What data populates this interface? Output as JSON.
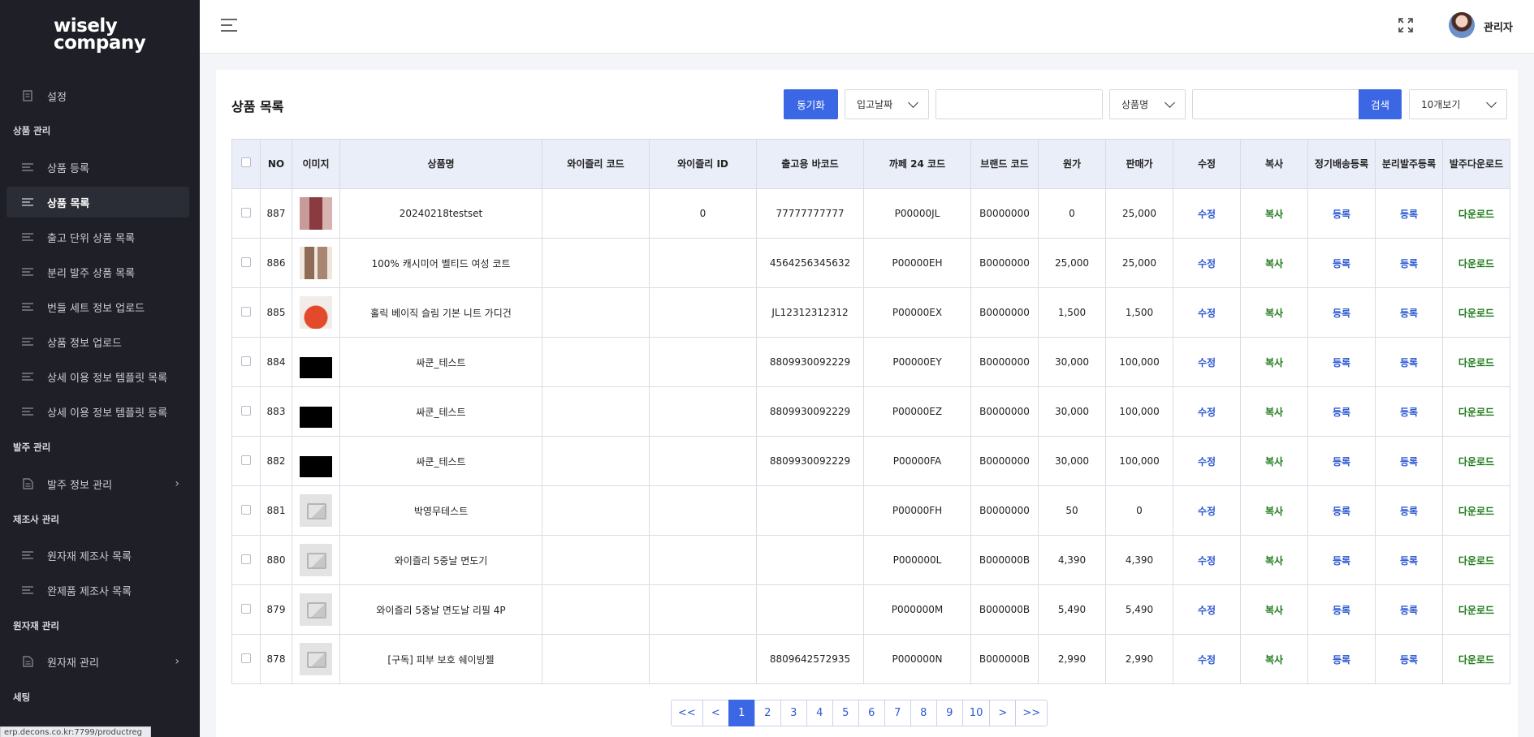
{
  "sidebar": {
    "logo_line1": "wisely",
    "logo_line2": "company",
    "settings": "설정",
    "section_product": "상품 관리",
    "product_items": [
      "상품 등록",
      "상품 목록",
      "출고 단위 상품 목록",
      "분리 발주 상품 목록",
      "번들 세트 정보 업로드",
      "상품 정보 업로드",
      "상세 이용 정보 템플릿 목록",
      "상세 이용 정보 템플릿 등록"
    ],
    "section_order": "발주 관리",
    "order_info": "발주 정보 관리",
    "section_maker": "제조사 관리",
    "maker_items": [
      "원자재 제조사 목록",
      "완제품 제조사 목록"
    ],
    "section_material": "원자재 관리",
    "material_mgmt": "원자재 관리",
    "section_setting": "세팅",
    "status_url": "erp.decons.co.kr:7799/productreg"
  },
  "topbar": {
    "user_name": "관리자"
  },
  "main": {
    "title": "상품 목록",
    "sync_button": "동기화",
    "date_filter": "입고날짜",
    "field_filter": "상품명",
    "search_button": "검색",
    "page_size": "10개보기"
  },
  "table": {
    "headers": [
      "NO",
      "이미지",
      "상품명",
      "와이즐리 코드",
      "와이즐리 ID",
      "출고용 바코드",
      "까페 24 코드",
      "브랜드 코드",
      "원가",
      "판매가",
      "수정",
      "복사",
      "정기배송등록",
      "분리발주등록",
      "발주다운로드"
    ],
    "rows": [
      {
        "no": "887",
        "img": "dress",
        "name": "20240218testset",
        "wcode": "",
        "wid": "0",
        "barcode": "77777777777",
        "cafe": "P00000JL",
        "brand": "B0000000",
        "cost": "0",
        "price": "25,000"
      },
      {
        "no": "886",
        "img": "coat",
        "name": "100% 캐시미어 벨티드 여성 코트",
        "wcode": "",
        "wid": "",
        "barcode": "4564256345632",
        "cafe": "P00000EH",
        "brand": "B0000000",
        "cost": "25,000",
        "price": "25,000"
      },
      {
        "no": "885",
        "img": "cardigan",
        "name": "홀릭 베이직 슬림 기본 니트 가디건",
        "wcode": "",
        "wid": "",
        "barcode": "JL12312312312",
        "cafe": "P00000EX",
        "brand": "B0000000",
        "cost": "1,500",
        "price": "1,500"
      },
      {
        "no": "884",
        "img": "black",
        "name": "싸쿤_테스트",
        "wcode": "",
        "wid": "",
        "barcode": "8809930092229",
        "cafe": "P00000EY",
        "brand": "B0000000",
        "cost": "30,000",
        "price": "100,000"
      },
      {
        "no": "883",
        "img": "black",
        "name": "싸쿤_테스트",
        "wcode": "",
        "wid": "",
        "barcode": "8809930092229",
        "cafe": "P00000EZ",
        "brand": "B0000000",
        "cost": "30,000",
        "price": "100,000"
      },
      {
        "no": "882",
        "img": "black",
        "name": "싸쿤_테스트",
        "wcode": "",
        "wid": "",
        "barcode": "8809930092229",
        "cafe": "P00000FA",
        "brand": "B0000000",
        "cost": "30,000",
        "price": "100,000"
      },
      {
        "no": "881",
        "img": "placeholder",
        "name": "박영무테스트",
        "wcode": "",
        "wid": "",
        "barcode": "",
        "cafe": "P00000FH",
        "brand": "B0000000",
        "cost": "50",
        "price": "0"
      },
      {
        "no": "880",
        "img": "placeholder",
        "name": "와이즐리 5중날 면도기",
        "wcode": "",
        "wid": "",
        "barcode": "",
        "cafe": "P000000L",
        "brand": "B000000B",
        "cost": "4,390",
        "price": "4,390"
      },
      {
        "no": "879",
        "img": "placeholder",
        "name": "와이즐리 5중날 면도날 리필 4P",
        "wcode": "",
        "wid": "",
        "barcode": "",
        "cafe": "P000000M",
        "brand": "B000000B",
        "cost": "5,490",
        "price": "5,490"
      },
      {
        "no": "878",
        "img": "placeholder",
        "name": "[구독] 피부 보호 쉐이빙젤",
        "wcode": "",
        "wid": "",
        "barcode": "8809642572935",
        "cafe": "P000000N",
        "brand": "B000000B",
        "cost": "2,990",
        "price": "2,990"
      }
    ],
    "action_edit": "수정",
    "action_copy": "복사",
    "action_register": "등록",
    "action_download": "다운로드"
  },
  "pagination": {
    "items": [
      "<<",
      "<",
      "1",
      "2",
      "3",
      "4",
      "5",
      "6",
      "7",
      "8",
      "9",
      "10",
      ">",
      ">>"
    ],
    "active": "1"
  },
  "colors": {
    "sidebar_bg": "#1f2027",
    "primary": "#3b67e5",
    "link_blue": "#2f5bd3",
    "link_green": "#1d7a18",
    "table_header_bg": "#e9eef8"
  }
}
